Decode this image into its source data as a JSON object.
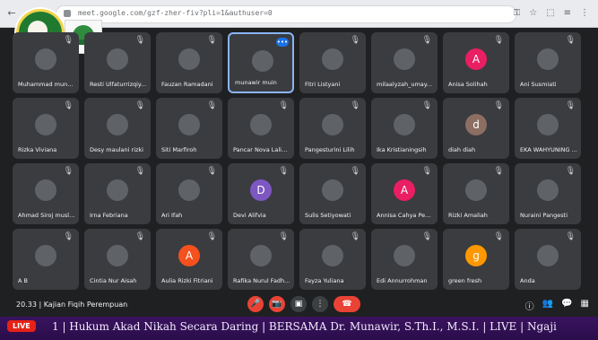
{
  "browser": {
    "url": "meet.google.com/gzf-zher-fiv?pli=1&authuser=0",
    "toolbar_icons": [
      "key-icon",
      "star-icon",
      "extensions-icon",
      "menu-icon",
      "more-icon"
    ]
  },
  "logos": {
    "left_logo": "round green and gold seal",
    "right_logo": "green dome emblem"
  },
  "participants": [
    {
      "name": "Muhammad muna...",
      "avatar": "photo",
      "muted": true
    },
    {
      "name": "Resti Ulfaturrizqiy...",
      "avatar": "photo",
      "muted": true
    },
    {
      "name": "Fauzan Ramadani",
      "avatar": "photo",
      "muted": true
    },
    {
      "name": "munawir muin",
      "avatar": "photo",
      "speaking": true
    },
    {
      "name": "Fitri Listyani",
      "avatar": "photo",
      "muted": true
    },
    {
      "name": "milaalyzah_umay...",
      "avatar": "photo",
      "muted": true
    },
    {
      "name": "Anisa Solihah",
      "avatar": "A",
      "muted": true
    },
    {
      "name": "Ani Susmiati",
      "avatar": "photo",
      "muted": true
    },
    {
      "name": "Rizka Viviana",
      "avatar": "photo",
      "muted": true
    },
    {
      "name": "Desy maulani rizki",
      "avatar": "photo",
      "muted": true
    },
    {
      "name": "Siti Marfiroh",
      "avatar": "photo",
      "muted": true
    },
    {
      "name": "Pancar Nova Lalia...",
      "avatar": "photo",
      "muted": true
    },
    {
      "name": "Pangesturini Lilih",
      "avatar": "photo",
      "muted": true
    },
    {
      "name": "Ika Kristianingsih",
      "avatar": "photo",
      "muted": true
    },
    {
      "name": "diah diah",
      "avatar": "d",
      "muted": true
    },
    {
      "name": "EKA WAHYUNING ...",
      "avatar": "photo",
      "muted": true
    },
    {
      "name": "Ahmad Siroj musli...",
      "avatar": "photo",
      "muted": true
    },
    {
      "name": "Irna Febriana",
      "avatar": "photo",
      "muted": true
    },
    {
      "name": "Ari Ifah",
      "avatar": "photo",
      "muted": true
    },
    {
      "name": "Devi Alifvia",
      "avatar": "D",
      "muted": true
    },
    {
      "name": "Sulis Setiyowati",
      "avatar": "photo",
      "muted": true
    },
    {
      "name": "Annisa Cahya Pen...",
      "avatar": "A",
      "muted": true
    },
    {
      "name": "Rizki Amaliah",
      "avatar": "photo",
      "muted": true
    },
    {
      "name": "Nuraini Pangesti",
      "avatar": "photo",
      "muted": true
    },
    {
      "name": "A B",
      "avatar": "photo",
      "muted": true
    },
    {
      "name": "Cintia Nur Aisah",
      "avatar": "photo",
      "muted": true
    },
    {
      "name": "Aulia Rizki Fitriani",
      "avatar": "A",
      "muted": true
    },
    {
      "name": "Rafika Nurul Fadhi...",
      "avatar": "photo",
      "muted": true
    },
    {
      "name": "Fayza Yuliana",
      "avatar": "photo",
      "muted": true
    },
    {
      "name": "Edi Annurrohman",
      "avatar": "photo",
      "muted": true
    },
    {
      "name": "green fresh",
      "avatar": "g",
      "muted": true
    },
    {
      "name": "Anda",
      "avatar": "photo",
      "muted": true
    }
  ],
  "avatar_colors": {
    "A": "#e91e63",
    "d": "#8d6e63",
    "D": "#7e57c2",
    "g": "#ff9800",
    "photo": "#5f6368",
    "A2": "#f4511e"
  },
  "meeting": {
    "time": "20.33",
    "title": "Kajian Fiqih Perempuan"
  },
  "controls": [
    "mic-off-icon",
    "camera-off-icon",
    "present-icon",
    "more-icon",
    "hangup-icon"
  ],
  "right_icons": [
    "info-icon",
    "people-icon",
    "chat-icon",
    "activities-icon"
  ],
  "ticker": {
    "live_label": "LIVE",
    "text": "1 | Hukum Akad Nikah Secara Daring | BERSAMA Dr. Munawir, S.Th.I., M.S.I. | LIVE | Ngaji"
  }
}
